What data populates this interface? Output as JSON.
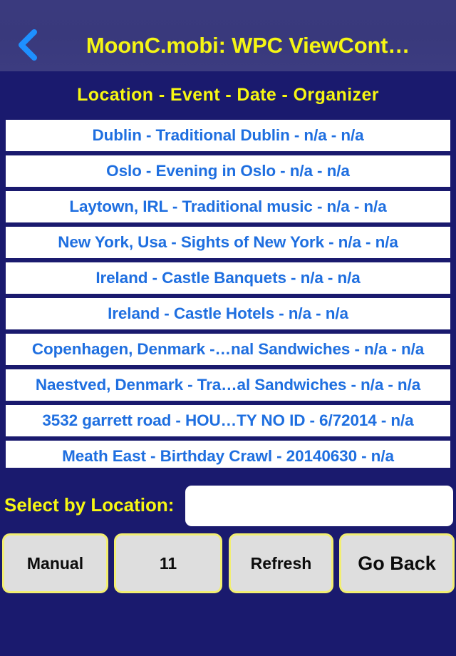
{
  "navbar": {
    "back_icon": "chevron-left-icon",
    "title": "MoonC.mobi: WPC ViewCont…",
    "background_color": "#39397c",
    "title_color": "#f5f514",
    "back_icon_color": "#1e90ff"
  },
  "columns_header": "Location  -  Event  -  Date  - Organizer",
  "list": {
    "rows": [
      {
        "label": "Dublin - Traditional Dublin - n/a - n/a"
      },
      {
        "label": "Oslo - Evening in Oslo - n/a - n/a"
      },
      {
        "label": "Laytown, IRL - Traditional music - n/a - n/a"
      },
      {
        "label": "New York, Usa - Sights of New York - n/a - n/a"
      },
      {
        "label": "Ireland - Castle Banquets - n/a - n/a"
      },
      {
        "label": "Ireland - Castle Hotels - n/a - n/a"
      },
      {
        "label": "Copenhagen, Denmark -…nal Sandwiches - n/a - n/a"
      },
      {
        "label": "Naestved, Denmark - Tra…al Sandwiches - n/a - n/a"
      },
      {
        "label": "3532 garrett road - HOU…TY NO ID - 6/72014 - n/a"
      },
      {
        "label": "Meath East - Birthday Crawl - 20140630 - n/a"
      }
    ],
    "row_background": "#ffffff",
    "row_text_color": "#1f6fe0"
  },
  "select_by": {
    "label": "Select by Location:",
    "input_value": "",
    "input_placeholder": ""
  },
  "buttons": {
    "manual": "Manual",
    "count": "11",
    "refresh": "Refresh",
    "go_back": "Go Back",
    "face_color": "#dedede",
    "border_color": "#f2ee72"
  },
  "theme": {
    "body_background": "#1a1a6e",
    "accent_yellow": "#f7f712"
  }
}
